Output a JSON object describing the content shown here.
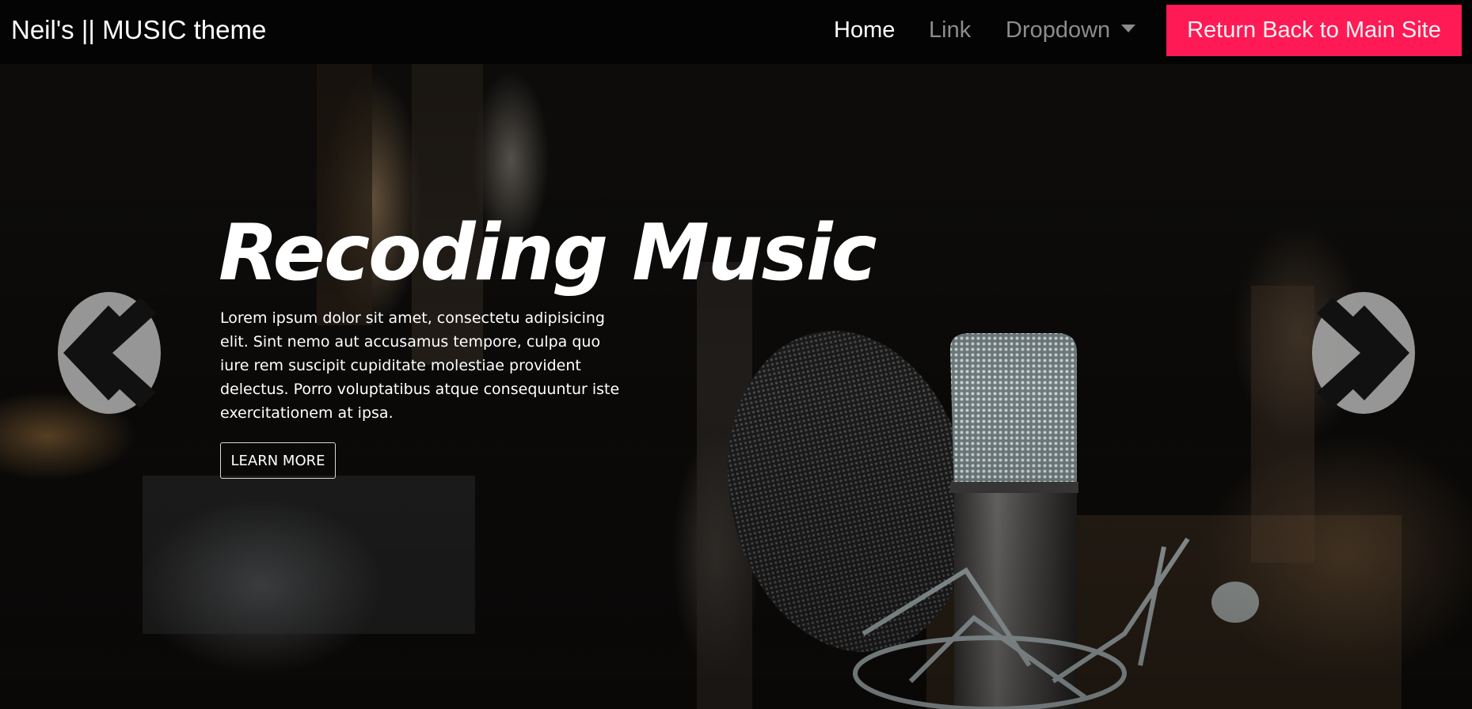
{
  "navbar": {
    "brand": "Neil's || MUSIC theme",
    "items": [
      {
        "label": "Home",
        "active": true
      },
      {
        "label": "Link",
        "active": false
      },
      {
        "label": "Dropdown",
        "active": false
      }
    ],
    "cta_label": "Return Back to Main Site",
    "colors": {
      "background": "#040404",
      "cta": "#ff1a55",
      "active": "#ffffff",
      "inactive": "#8c8c8c"
    }
  },
  "hero": {
    "title": "Recoding Music",
    "text": "Lorem ipsum dolor sit amet, consectetu adipisicing elit. Sint nemo aut accusamus tempore, culpa quo iure rem suscipit cupiditate molestiae provident delectus. Porro voluptatibus atque consequuntur iste exercitationem at ipsa.",
    "button_label": "LEARN MORE",
    "background_image": "studio-microphone-photo"
  },
  "carousel": {
    "prev_icon": "double-chevron-left-icon",
    "next_icon": "double-chevron-right-icon"
  }
}
